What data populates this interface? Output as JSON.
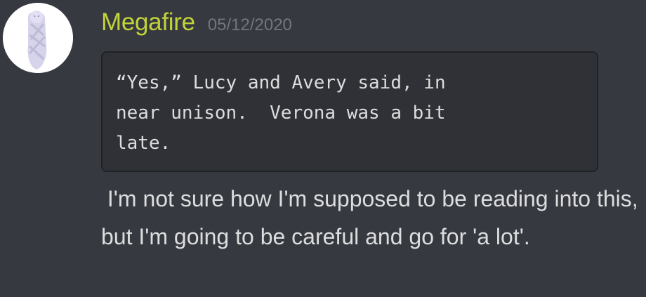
{
  "message": {
    "avatar_icon": "avatar-figure-icon",
    "username": "Megafire",
    "timestamp": "05/12/2020",
    "code_block": "“Yes,” Lucy and Avery said, in\nnear unison.  Verona was a bit\nlate.",
    "text": " I'm not sure how I'm supposed to be reading into this, but I'm going to be careful and go for 'a lot'."
  },
  "colors": {
    "background": "#36393f",
    "username": "#c2d33a",
    "timestamp": "#72767d",
    "text": "#dcddde",
    "code_background": "#2f3136",
    "code_border": "#202225"
  }
}
